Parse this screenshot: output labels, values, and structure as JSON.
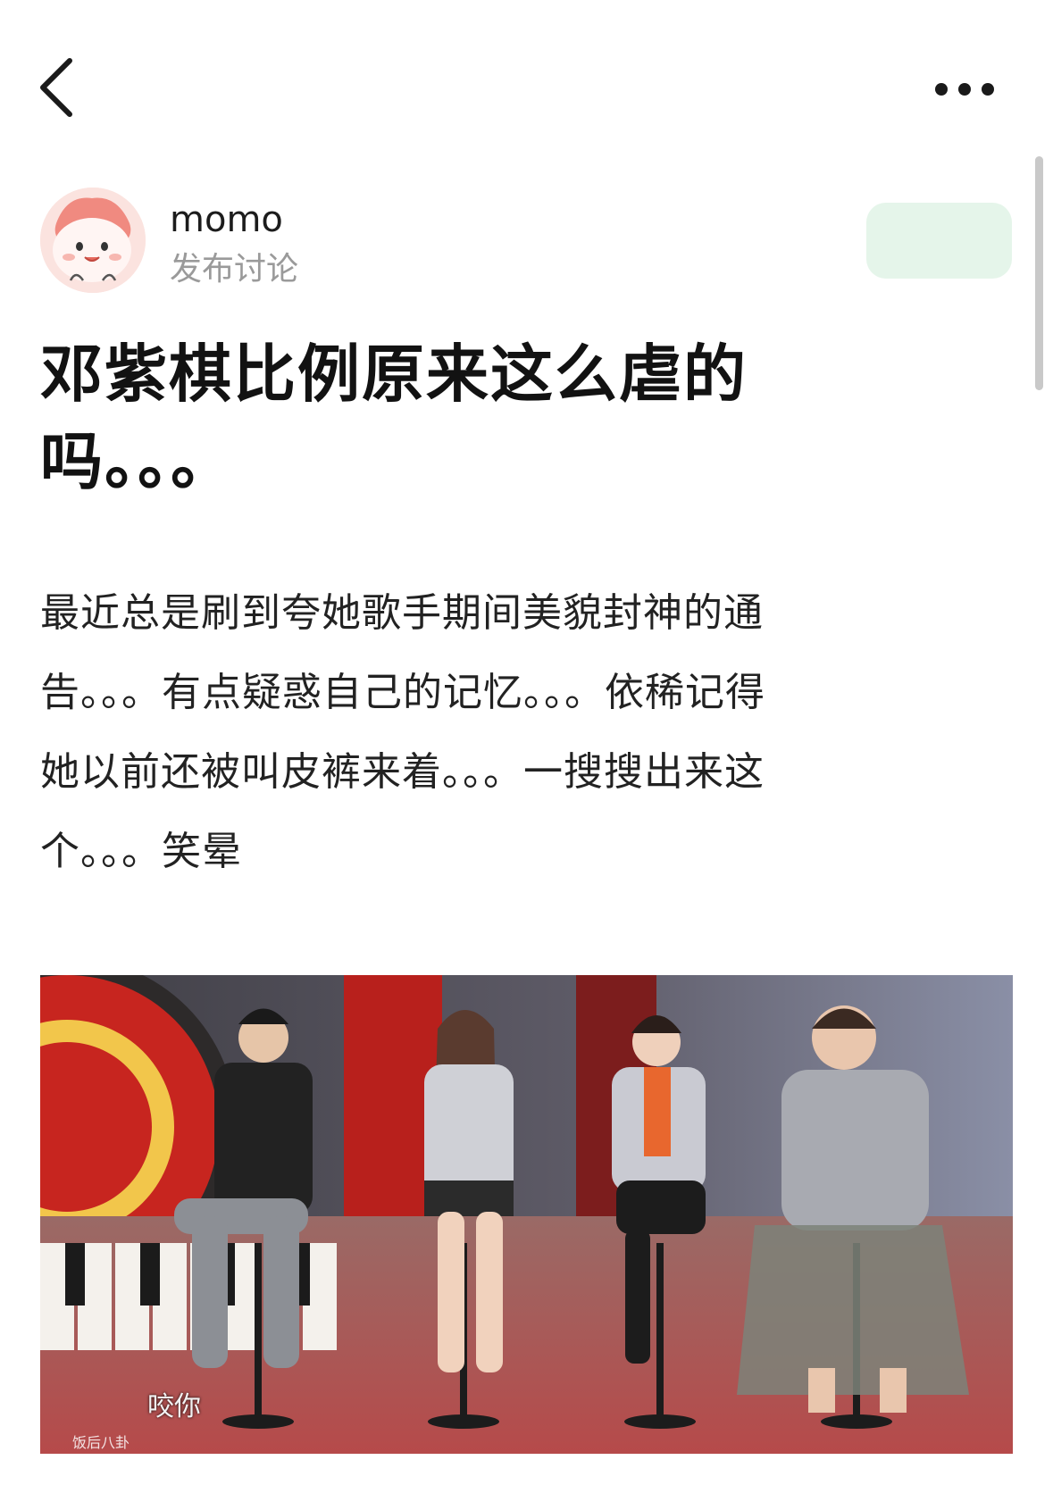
{
  "nav": {
    "back_icon": "chevron-left-icon",
    "more_icon": "more-dots-icon"
  },
  "author": {
    "name": "momo",
    "subtitle": "发布讨论",
    "avatar_icon": "cartoon-avatar"
  },
  "post": {
    "title_line1": "邓紫棋比例原来这么虐的",
    "title_line2": "吗。。。",
    "body_line1": "最近总是刷到夸她歌手期间美貌封神的通",
    "body_line2": "告。。。有点疑惑自己的记忆。。。依稀记得",
    "body_line3": "她以前还被叫皮裤来着。。。一搜搜出来这",
    "body_line4": "个。。。笑晕"
  },
  "photo": {
    "subtitle_text": "咬你",
    "watermark_text": "饭后八卦"
  },
  "colors": {
    "follow_bg": "#e5f5ea",
    "subtle_text": "#9a9a9a"
  }
}
